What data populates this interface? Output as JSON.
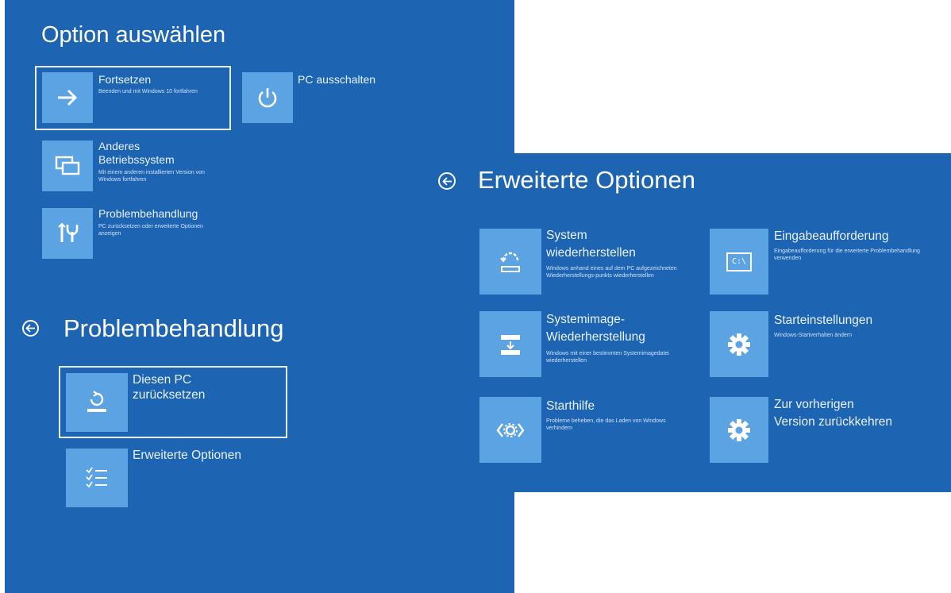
{
  "screen1": {
    "title": "Option auswählen",
    "items": [
      {
        "label": "Fortsetzen",
        "desc": "Beenden und mit Windows 10 fortfahren",
        "icon": "arrow-right-icon"
      },
      {
        "label": "PC ausschalten",
        "icon": "power-icon"
      },
      {
        "label_line1": "Anderes",
        "label_line2": "Betriebssystem",
        "desc": "Mit einem anderen installierten Version von Windows fortfahren",
        "icon": "windows-stack-icon"
      },
      {
        "label": "Problembehandlung",
        "desc": "PC zurücksetzen oder erweiterte Optionen anzeigen",
        "icon": "tools-icon"
      }
    ]
  },
  "screen2": {
    "title": "Problembehandlung",
    "items": [
      {
        "label_line1": "Diesen PC",
        "label_line2": "zurücksetzen",
        "icon": "reset-pc-icon"
      },
      {
        "label": "Erweiterte Optionen",
        "icon": "checklist-icon"
      }
    ]
  },
  "screen3": {
    "title": "Erweiterte Optionen",
    "items": [
      {
        "label_line1": "System",
        "label_line2": "wiederherstellen",
        "desc": "Windows anhand eines auf dem PC aufgezeichneten Wiederherstellungs-punkts wiederherstellen",
        "icon": "system-restore-icon"
      },
      {
        "label": "Eingabeaufforderung",
        "desc": "Eingabeaufforderung für die erweiterte Problembehandlung verwenden",
        "icon": "command-prompt-icon",
        "icon_text": "C:\\"
      },
      {
        "label_line1": "Systemimage-",
        "label_line2": "Wiederherstellung",
        "desc": "Windows mit einer bestimmten Systemimagedatei wiederherstellen",
        "icon": "system-image-icon"
      },
      {
        "label": "Starteinstellungen",
        "desc": "Windows-Startverhalten ändern",
        "icon": "gear-icon"
      },
      {
        "label": "Starthilfe",
        "desc": "Probleme beheben, die das Laden von Windows verhindern",
        "icon": "startup-repair-icon"
      },
      {
        "label_line1": "Zur vorherigen",
        "label_line2": "Version zurückkehren",
        "icon": "gear-icon"
      }
    ]
  }
}
